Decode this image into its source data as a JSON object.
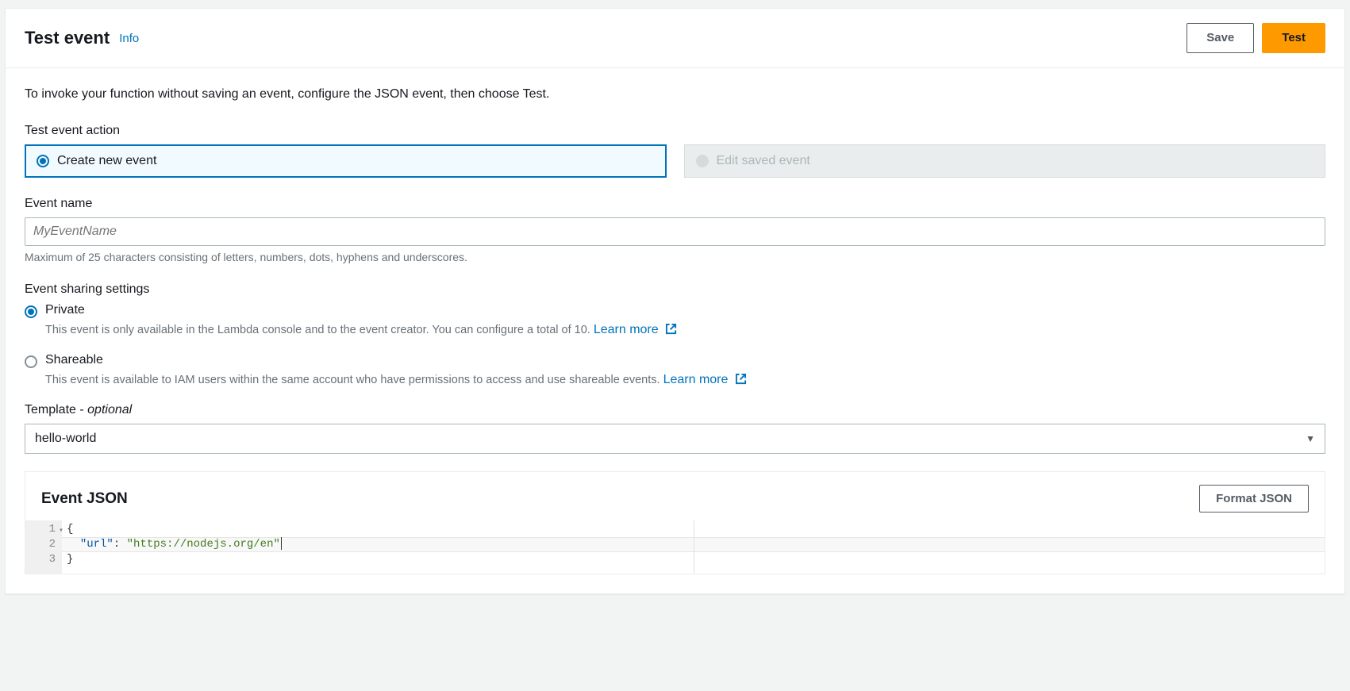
{
  "header": {
    "title": "Test event",
    "info_link": "Info",
    "save_label": "Save",
    "test_label": "Test"
  },
  "intro": "To invoke your function without saving an event, configure the JSON event, then choose Test.",
  "action": {
    "label": "Test event action",
    "create_label": "Create new event",
    "edit_label": "Edit saved event"
  },
  "event_name": {
    "label": "Event name",
    "placeholder": "MyEventName",
    "helper": "Maximum of 25 characters consisting of letters, numbers, dots, hyphens and underscores."
  },
  "sharing": {
    "label": "Event sharing settings",
    "private": {
      "title": "Private",
      "desc": "This event is only available in the Lambda console and to the event creator. You can configure a total of 10. ",
      "learn": "Learn more"
    },
    "shareable": {
      "title": "Shareable",
      "desc": "This event is available to IAM users within the same account who have permissions to access and use shareable events. ",
      "learn": "Learn more"
    }
  },
  "template": {
    "label_prefix": "Template - ",
    "label_optional": "optional",
    "value": "hello-world"
  },
  "json": {
    "title": "Event JSON",
    "format_label": "Format JSON",
    "lines": [
      "1",
      "2",
      "3"
    ],
    "code_key": "\"url\"",
    "code_val": "\"https://nodejs.org/en\""
  }
}
